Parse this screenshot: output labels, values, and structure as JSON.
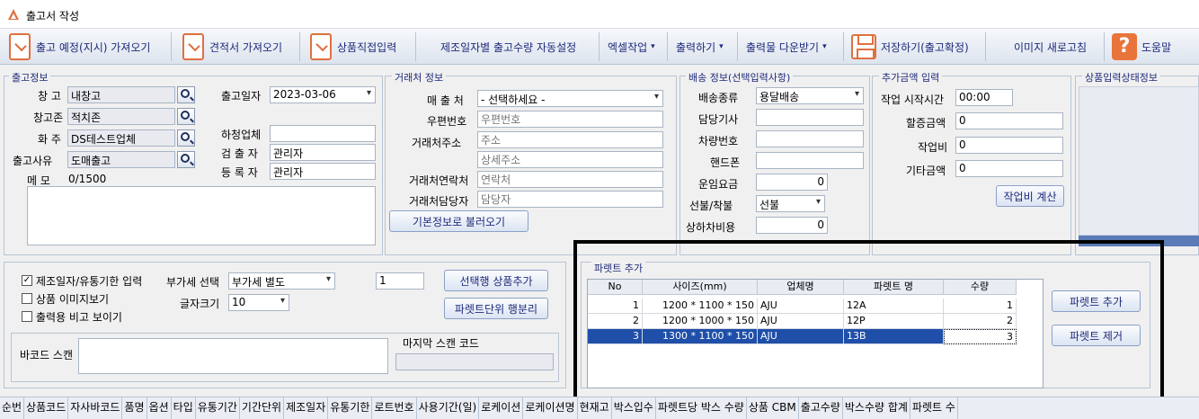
{
  "window": {
    "title": "출고서 작성"
  },
  "toolbar": {
    "load_order": "출고 예정(지시) 가져오기",
    "load_estimate": "견적서 가져오기",
    "direct_input": "상품직접입력",
    "auto_qty": "제조일자별 출고수량 자동설정",
    "excel": "엑셀작업",
    "print": "출력하기",
    "download": "출력물 다운받기",
    "save": "저장하기(출고확정)",
    "refresh_image": "이미지 새로고침",
    "help": "도움말"
  },
  "shipment_info": {
    "title": "출고정보",
    "warehouse_label": "창 고",
    "warehouse": "내창고",
    "zone_label": "창고존",
    "zone": "적치존",
    "shipper_label": "화 주",
    "shipper": "DS테스트업체",
    "reason_label": "출고사유",
    "reason": "도매출고",
    "date_label": "출고일자",
    "date": "2023-03-06",
    "subcontractor_label": "하청업체",
    "subcontractor": "",
    "inspector_label": "검 출 자",
    "inspector": "관리자",
    "registrant_label": "등 록 자",
    "registrant": "관리자",
    "memo_label": "메  모",
    "memo_count": "0/1500"
  },
  "client_info": {
    "title": "거래처 정보",
    "client_label": "매 출 처",
    "client": "- 선택하세요 -",
    "zip_label": "우편번호",
    "zip_placeholder": "우편번호",
    "address_label": "거래처주소",
    "address_placeholder": "주소",
    "address_detail_placeholder": "상세주소",
    "phone_label": "거래처연락처",
    "phone_placeholder": "연락처",
    "contact_label": "거래처담당자",
    "contact_placeholder": "담당자",
    "load_button": "기본정보로 불러오기"
  },
  "delivery_info": {
    "title": "배송 정보(선택입력사항)",
    "type_label": "배송종류",
    "type": "용달배송",
    "driver_label": "담당기사",
    "vehicle_label": "차량번호",
    "mobile_label": "핸드폰",
    "fare_label": "운임요금",
    "fare": "0",
    "prepaid_label": "선불/착불",
    "prepaid": "선불",
    "handling_label": "상하차비용",
    "handling": "0"
  },
  "extra_amount": {
    "title": "추가금액 입력",
    "start_label": "작업 시작시간",
    "start": "00:00",
    "surcharge_label": "할증금액",
    "surcharge": "0",
    "work_fee_label": "작업비",
    "work_fee": "0",
    "other_label": "기타금액",
    "other": "0",
    "calc_button": "작업비 계산"
  },
  "product_status": {
    "title": "상품입력상태정보"
  },
  "options": {
    "mfg_input": "제조일자/유통기한 입력",
    "show_image": "상품 이미지보기",
    "show_print_note": "출력용 비고 보이기",
    "vat_label": "부가세 선택",
    "vat": "부가세 별도",
    "font_label": "글자크기",
    "font_size": "10",
    "qty": "1",
    "add_selected": "선택행 상품추가",
    "split_pallet": "파렛트단위 행분리",
    "barcode_label": "바코드 스캔",
    "last_scan_label": "마지막 스캔 코드"
  },
  "pallet": {
    "title": "파렛트 추가",
    "headers": [
      "No",
      "사이즈(mm)",
      "업체명",
      "파렛트 명",
      "수량"
    ],
    "rows": [
      [
        "1",
        "1200 * 1100 * 150",
        "AJU",
        "12A",
        "1"
      ],
      [
        "2",
        "1200 * 1000 * 150",
        "AJU",
        "12P",
        "2"
      ],
      [
        "3",
        "1300 * 1100 * 150",
        "AJU",
        "13B",
        "3"
      ]
    ],
    "add_button": "파렛트 추가",
    "remove_button": "파렛트 제거"
  },
  "bottom_columns": [
    "순번",
    "상품코드",
    "자사바코드",
    "품명",
    "옵션",
    "타입",
    "유통기간",
    "기간단위",
    "제조일자",
    "유통기한",
    "로트번호",
    "사용기간(일)",
    "로케이션",
    "로케이션명",
    "현재고",
    "박스입수",
    "파렛트당 박스 수량",
    "상품 CBM",
    "출고수량",
    "박스수량 합계",
    "파렛트 수"
  ],
  "colors": {
    "accent": "#e07040",
    "selected_row": "#1f4fa8",
    "highlight_box": "#000000"
  }
}
